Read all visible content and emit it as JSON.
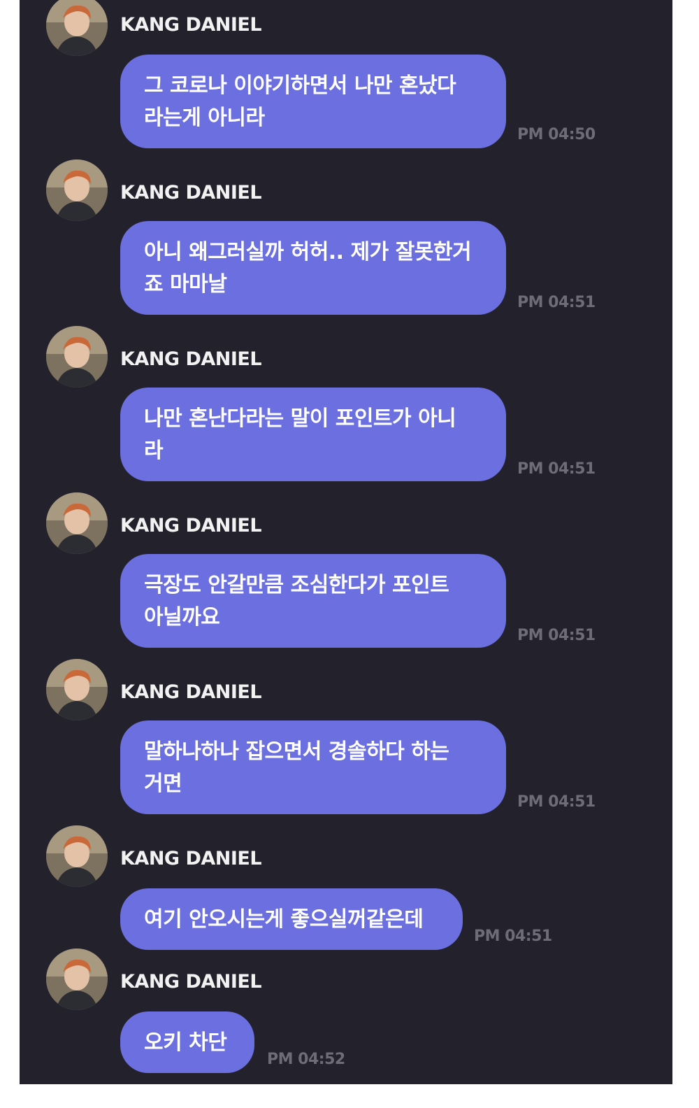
{
  "messages": [
    {
      "sender": "KANG DANIEL",
      "lines": [
        "그 코로나 이야기하면서 나만 혼났다",
        "라는게 아니라"
      ],
      "time": "PM 04:50"
    },
    {
      "sender": "KANG DANIEL",
      "lines": [
        "아니 왜그러실까 허허.. 제가 잘못한거",
        "죠 마마날"
      ],
      "time": "PM 04:51"
    },
    {
      "sender": "KANG DANIEL",
      "lines": [
        "나만 혼난다라는 말이 포인트가 아니",
        "라"
      ],
      "time": "PM 04:51"
    },
    {
      "sender": "KANG DANIEL",
      "lines": [
        "극장도 안갈만큼 조심한다가 포인트",
        "아닐까요"
      ],
      "time": "PM 04:51"
    },
    {
      "sender": "KANG DANIEL",
      "lines": [
        "말하나하나 잡으면서 경솔하다 하는",
        "거면"
      ],
      "time": "PM 04:51"
    },
    {
      "sender": "KANG DANIEL",
      "lines": [
        "여기 안오시는게 좋으실꺼같은데"
      ],
      "time": "PM 04:51"
    },
    {
      "sender": "KANG DANIEL",
      "lines": [
        "오키 차단"
      ],
      "time": "PM 04:52"
    }
  ],
  "colors": {
    "background": "#23222c",
    "bubble": "#6b6fe0",
    "time": "#6e6d77"
  },
  "icons": {
    "avatar": "profile-photo-avatar"
  }
}
